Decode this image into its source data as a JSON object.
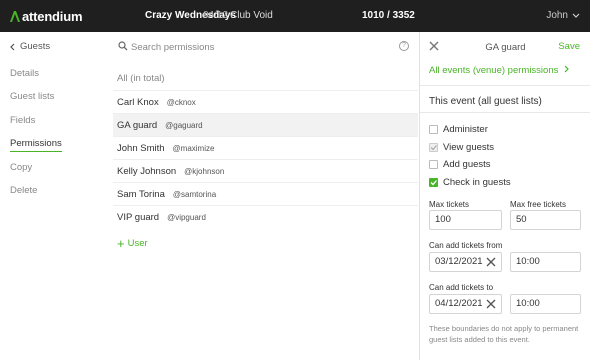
{
  "topbar": {
    "logo": "attendium",
    "event_name": "Crazy Wednesdays",
    "event_date": "04/12",
    "venue": "Club Void",
    "count": "1010 / 3352",
    "user": "John"
  },
  "leftnav": {
    "back_label": "Guests",
    "items": [
      "Details",
      "Guest lists",
      "Fields",
      "Permissions",
      "Copy",
      "Delete"
    ],
    "active": "Permissions"
  },
  "search": {
    "placeholder": "Search permissions"
  },
  "list": {
    "header": "All (in total)",
    "rows": [
      {
        "name": "Carl Knox",
        "handle": "@cknox"
      },
      {
        "name": "GA guard",
        "handle": "@gaguard"
      },
      {
        "name": "John Smith",
        "handle": "@maximize"
      },
      {
        "name": "Kelly Johnson",
        "handle": "@kjohnson"
      },
      {
        "name": "Sam Torina",
        "handle": "@samtorina"
      },
      {
        "name": "VIP guard",
        "handle": "@vipguard"
      }
    ],
    "add_label": "User"
  },
  "panel": {
    "title": "GA guard",
    "save_label": "Save",
    "all_events_link": "All events (venue) permissions",
    "section_title": "This event (all guest lists)",
    "checks": [
      {
        "label": "Administer",
        "state": "unchecked"
      },
      {
        "label": "View guests",
        "state": "disabled"
      },
      {
        "label": "Add guests",
        "state": "unchecked"
      },
      {
        "label": "Check in guests",
        "state": "checked"
      }
    ],
    "max_tickets_label": "Max tickets",
    "max_tickets": "100",
    "max_free_label": "Max free tickets",
    "max_free": "50",
    "from_label": "Can add tickets from",
    "from_date": "03/12/2021",
    "from_time": "10:00",
    "to_label": "Can add tickets to",
    "to_date": "04/12/2021",
    "to_time": "10:00",
    "note": "These boundaries do not apply to permanent guest lists added to this event."
  },
  "colors": {
    "accent": "#49b427",
    "topbar": "#1f1f1f"
  }
}
